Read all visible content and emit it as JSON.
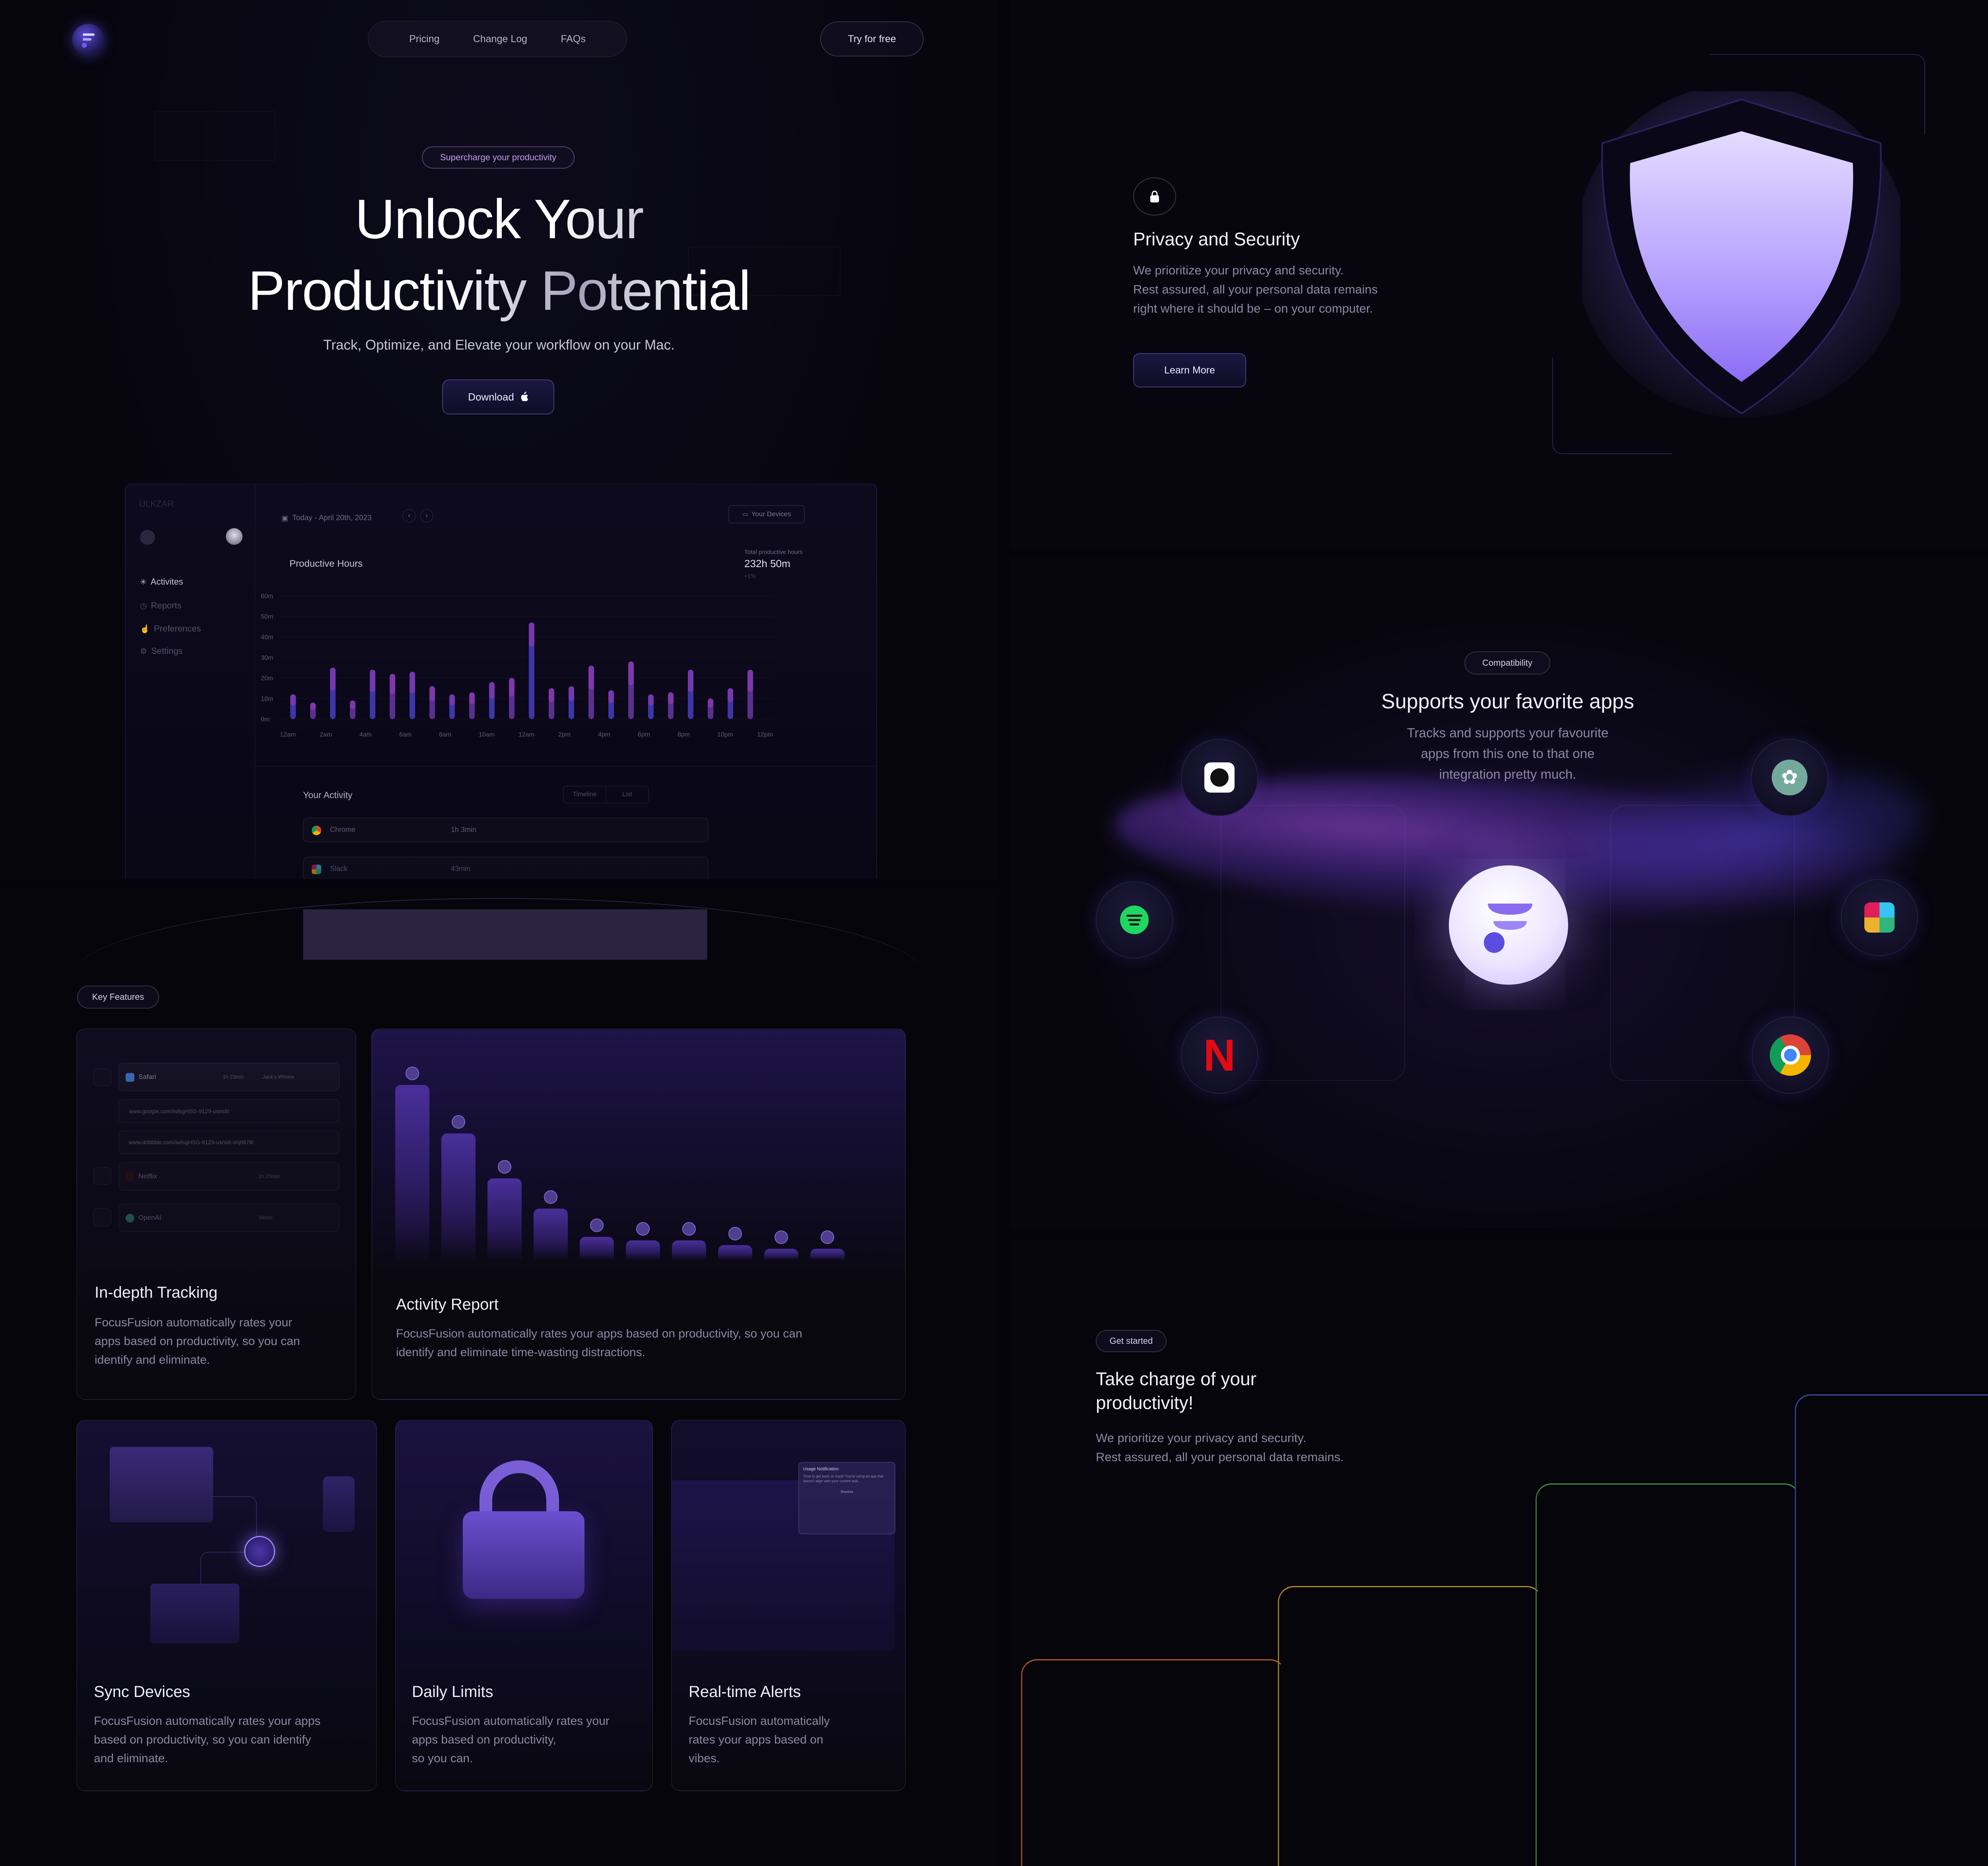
{
  "nav": {
    "links": [
      "Pricing",
      "Change Log",
      "FAQs"
    ],
    "cta": "Try for free"
  },
  "hero": {
    "badge": "Supercharge your productivity",
    "title_line1": "Unlock Your",
    "title_line2": "Productivity Potential",
    "subtitle": "Track, Optimize, and Elevate your workflow on your Mac.",
    "download": "Download"
  },
  "dashboard": {
    "app_name": "ULKZAR",
    "date": "Today - April 20th, 2023",
    "devices": "Your Devices",
    "sidebar": [
      "Activites",
      "Reports",
      "Preferences",
      "Settings"
    ],
    "chart_title": "Productive Hours",
    "total_label": "Total productive hours",
    "total_value": "232h 50m",
    "total_sub": "+1%",
    "activity_title": "Your Activity",
    "toggle": [
      "Timeline",
      "List"
    ],
    "activity_rows": [
      {
        "app": "Chrome",
        "time": "1h 3min"
      },
      {
        "app": "Slack",
        "time": "43min"
      }
    ]
  },
  "chart_data": {
    "type": "bar",
    "title": "Productive Hours",
    "xlabel": "",
    "ylabel": "",
    "ylim": [
      0,
      60
    ],
    "y_ticks": [
      "0m",
      "10m",
      "20m",
      "30m",
      "40m",
      "50m",
      "60m"
    ],
    "x_ticks": [
      "12am",
      "2am",
      "4am",
      "6am",
      "8am",
      "10am",
      "12am",
      "2pm",
      "4pm",
      "6pm",
      "8pm",
      "10pm",
      "12pm"
    ],
    "series": [
      {
        "values": [
          12,
          8,
          25,
          9,
          24,
          22,
          23,
          16,
          12,
          13,
          18,
          20,
          47,
          15,
          16,
          26,
          14,
          28,
          12,
          13,
          24,
          10,
          15,
          24
        ]
      }
    ]
  },
  "privacy": {
    "title": "Privacy and Security",
    "desc1": "We prioritize your privacy and security.",
    "desc2": "Rest assured, all your personal data remains",
    "desc3": "right where it should be – on your computer.",
    "button": "Learn More"
  },
  "compat": {
    "badge": "Compatibility",
    "title": "Supports your favorite apps",
    "desc1": "Tracks and supports your favourite",
    "desc2": "apps from this one to that one",
    "desc3": "integration pretty much.",
    "apps": [
      "github-icon",
      "openai-icon",
      "spotify-icon",
      "slack-icon",
      "netflix-icon",
      "chrome-icon"
    ]
  },
  "features": {
    "badge": "Key Features",
    "tracking": {
      "title": "In-depth Tracking",
      "desc1": "FocusFusion automatically rates your",
      "desc2": "apps based on productivity, so you can",
      "desc3": "identify and eliminate.",
      "rows": [
        {
          "app": "Safari",
          "time": "1h 23min",
          "device": "Jack's iPhone"
        },
        {
          "app": "Netflix",
          "time": "1h 23min"
        },
        {
          "app": "OpenAI",
          "time": "36min"
        }
      ],
      "urls": [
        "www.google.com/iwlsgHSG-9129-usns8/",
        "www.dribbble.com/iwlsgHSG-9129-usns8-shj8678/"
      ]
    },
    "report": {
      "title": "Activity Report",
      "desc1": "FocusFusion automatically rates your apps based on productivity, so you can",
      "desc2": "identify and eliminate time-wasting distractions.",
      "bar_levels": [
        1.0,
        0.71,
        0.44,
        0.26,
        0.09,
        0.07,
        0.07,
        0.04,
        0.02,
        0.01
      ]
    },
    "sync": {
      "title": "Sync Devices",
      "desc1": "FocusFusion automatically rates your apps",
      "desc2": "based on productivity, so you can identify",
      "desc3": "and eliminate."
    },
    "limits": {
      "title": "Daily Limits",
      "desc1": "FocusFusion automatically rates your",
      "desc2": "apps based on productivity,",
      "desc3": "so you can."
    },
    "alerts": {
      "title": "Real-time Alerts",
      "desc1": "FocusFusion automatically",
      "desc2": "rates your apps based on",
      "desc3": "vibes.",
      "notif_title": "Usage Notification",
      "notif_body": "Time to get back on track! You're using an app that doesn't align with your current task.",
      "notif_button": "Dismiss"
    }
  },
  "started": {
    "badge": "Get started",
    "title1": "Take charge of your",
    "title2": "productivity!",
    "desc1": "We prioritize your privacy and security.",
    "desc2": "Rest assured, all your personal data remains."
  },
  "colors": {
    "accent": "#7b5cf0",
    "background": "#05040d",
    "shield": "#9d85ff"
  }
}
